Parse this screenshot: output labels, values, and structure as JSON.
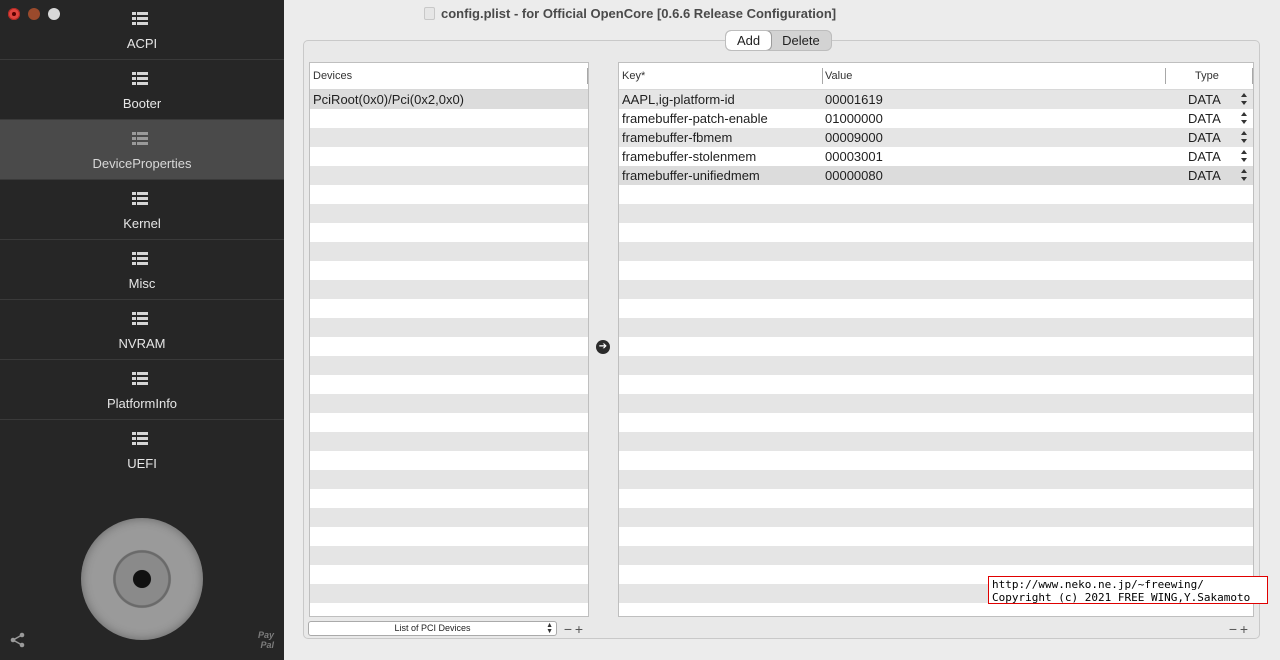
{
  "window": {
    "title": "config.plist - for Official OpenCore [0.6.6 Release Configuration]"
  },
  "sidebar": {
    "items": [
      {
        "label": "ACPI"
      },
      {
        "label": "Booter"
      },
      {
        "label": "DeviceProperties",
        "active": true
      },
      {
        "label": "Kernel"
      },
      {
        "label": "Misc"
      },
      {
        "label": "NVRAM"
      },
      {
        "label": "PlatformInfo"
      },
      {
        "label": "UEFI"
      }
    ],
    "paypal_line1": "Pay",
    "paypal_line2": "Pal"
  },
  "segmented": {
    "add": "Add",
    "delete": "Delete",
    "selected": "Add"
  },
  "devices_table": {
    "header": "Devices",
    "rows": [
      "PciRoot(0x0)/Pci(0x2,0x0)"
    ]
  },
  "props_table": {
    "headers": {
      "key": "Key*",
      "value": "Value",
      "type": "Type"
    },
    "rows": [
      {
        "key": "AAPL,ig-platform-id",
        "value": "00001619",
        "type": "DATA"
      },
      {
        "key": "framebuffer-patch-enable",
        "value": "01000000",
        "type": "DATA"
      },
      {
        "key": "framebuffer-fbmem",
        "value": "00009000",
        "type": "DATA"
      },
      {
        "key": "framebuffer-stolenmem",
        "value": "00003001",
        "type": "DATA"
      },
      {
        "key": "framebuffer-unifiedmem",
        "value": "00000080",
        "type": "DATA"
      }
    ]
  },
  "bottom": {
    "popup_label": "List of PCI Devices",
    "minus": "−",
    "plus": "+"
  },
  "watermark": {
    "line1": "http://www.neko.ne.jp/~freewing/",
    "line2": "Copyright (c) 2021 FREE WING,Y.Sakamoto"
  },
  "colors": {
    "sidebar_bg": "#262626",
    "sidebar_active": "#4a4a4a",
    "watermark_border": "#e00000"
  }
}
